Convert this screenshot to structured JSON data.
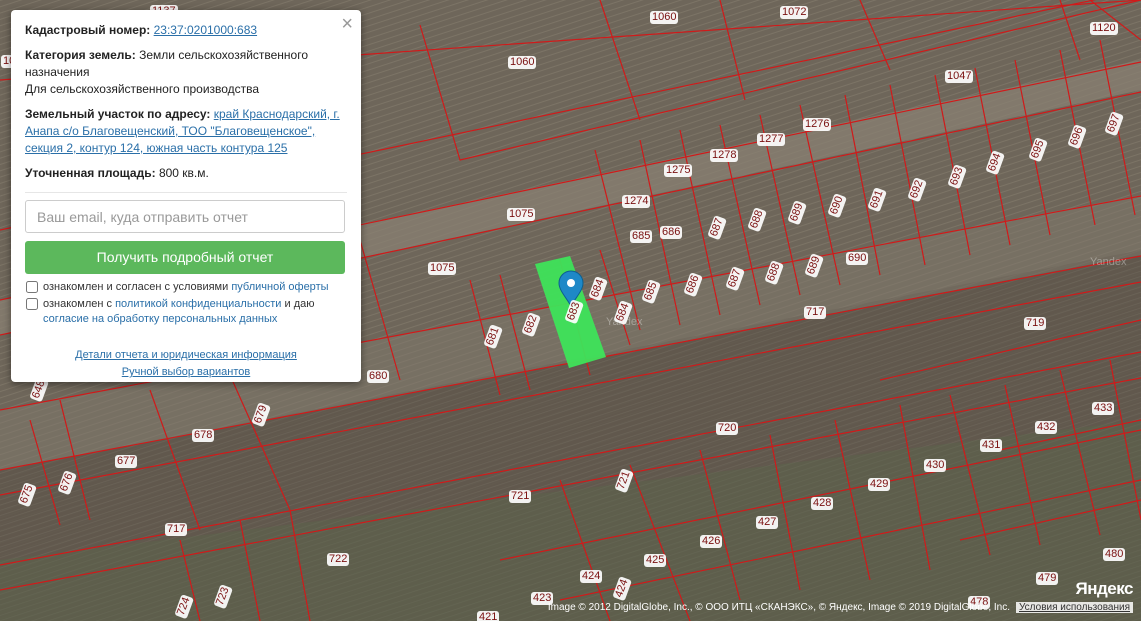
{
  "popup": {
    "cadastral_label": "Кадастровый номер:",
    "cadastral_value": "23:37:0201000:683",
    "category_label": "Категория земель:",
    "category_value": "Земли сельскохозяйственного назначения",
    "usage_value": "Для сельскохозяйственного производства",
    "address_label": "Земельный участок по адресу:",
    "address_value": "край Краснодарский, г. Анапа с/о Благовещенский, ТОО \"Благовещенское\", секция 2, контур 124, южная часть контура 125",
    "area_label": "Уточненная площадь:",
    "area_value": "800 кв.м.",
    "email_placeholder": "Ваш email, куда отправить отчет",
    "submit_label": "Получить подробный отчет",
    "check1_text": "ознакомлен и согласен с условиями",
    "check1_link": "публичной оферты",
    "check2_text": "ознакомлен с",
    "check2_link": "политикой конфиденциальности",
    "check2_text_after": "и даю",
    "check2_link2": "согласие на обработку персональных данных",
    "details_link": "Детали отчета и юридическая информация",
    "manual_link": "Ручной выбор вариантов",
    "close_symbol": "×"
  },
  "map": {
    "watermark": "Yandex",
    "logo": "Яндекс",
    "attribution": "Image © 2012 DigitalGlobe, Inc., © ООО ИТЦ «СКАНЭКС», © Яндекс, Image © 2019 DigitalGlobe, Inc.",
    "terms_link": "Условия использования",
    "highlight_color": "#3ee35a",
    "boundary_color": "#d01a1a",
    "parcels": [
      {
        "label": "1137"
      },
      {
        "label": "1060"
      },
      {
        "label": "1072"
      },
      {
        "label": "1120"
      },
      {
        "label": "1060"
      },
      {
        "label": "1047"
      },
      {
        "label": "1277"
      },
      {
        "label": "1276"
      },
      {
        "label": "1278"
      },
      {
        "label": "1275"
      },
      {
        "label": "697"
      },
      {
        "label": "696"
      },
      {
        "label": "695"
      },
      {
        "label": "694"
      },
      {
        "label": "693"
      },
      {
        "label": "692"
      },
      {
        "label": "691"
      },
      {
        "label": "690"
      },
      {
        "label": "689"
      },
      {
        "label": "688"
      },
      {
        "label": "687"
      },
      {
        "label": "686"
      },
      {
        "label": "685"
      },
      {
        "label": "1274"
      },
      {
        "label": "1075"
      },
      {
        "label": "1075"
      },
      {
        "label": "690"
      },
      {
        "label": "689"
      },
      {
        "label": "688"
      },
      {
        "label": "687"
      },
      {
        "label": "686"
      },
      {
        "label": "685"
      },
      {
        "label": "684"
      },
      {
        "label": "684"
      },
      {
        "label": "682"
      },
      {
        "label": "681"
      },
      {
        "label": "717"
      },
      {
        "label": "719"
      },
      {
        "label": "680"
      },
      {
        "label": "679"
      },
      {
        "label": "678"
      },
      {
        "label": "677"
      },
      {
        "label": "676"
      },
      {
        "label": "675"
      },
      {
        "label": "720"
      },
      {
        "label": "721"
      },
      {
        "label": "721"
      },
      {
        "label": "717"
      },
      {
        "label": "722"
      },
      {
        "label": "433"
      },
      {
        "label": "432"
      },
      {
        "label": "431"
      },
      {
        "label": "430"
      },
      {
        "label": "429"
      },
      {
        "label": "428"
      },
      {
        "label": "427"
      },
      {
        "label": "426"
      },
      {
        "label": "425"
      },
      {
        "label": "424"
      },
      {
        "label": "424"
      },
      {
        "label": "423"
      },
      {
        "label": "421"
      },
      {
        "label": "480"
      },
      {
        "label": "479"
      },
      {
        "label": "478"
      },
      {
        "label": "724"
      },
      {
        "label": "723"
      },
      {
        "label": "648"
      },
      {
        "label": "10"
      },
      {
        "label": "683"
      }
    ]
  }
}
